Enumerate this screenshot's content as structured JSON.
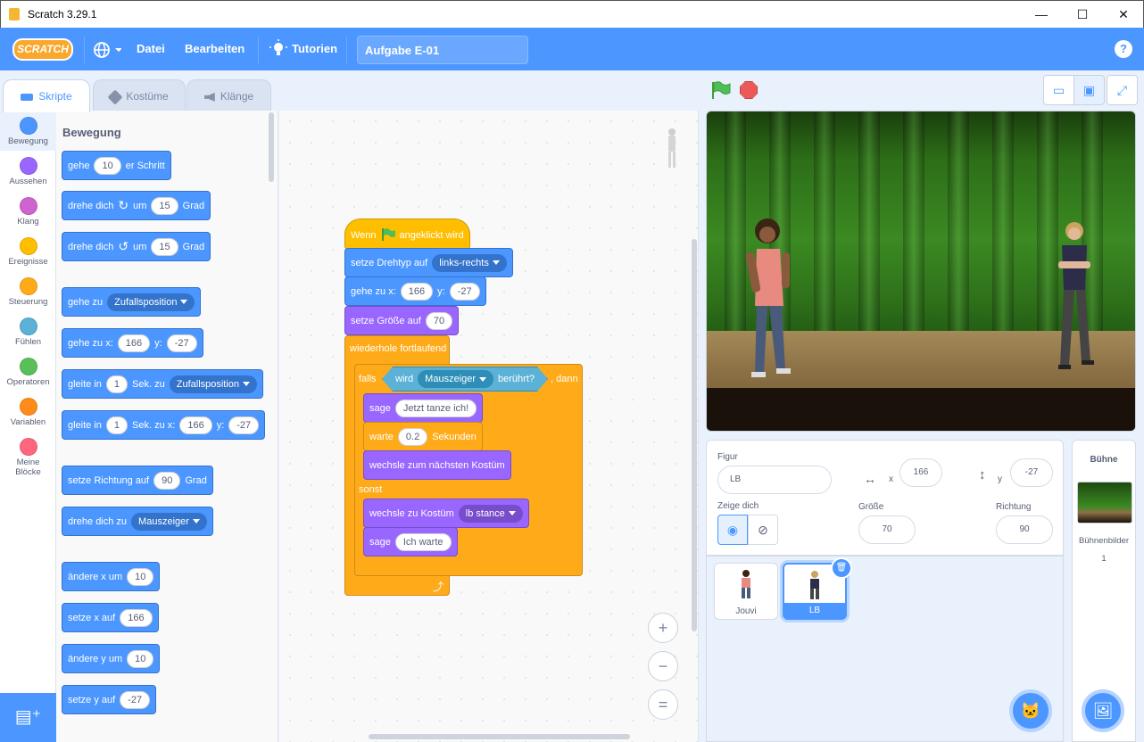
{
  "window": {
    "title": "Scratch 3.29.1",
    "minimize": "—",
    "maximize": "☐",
    "close": "✕"
  },
  "menu": {
    "logo": "SCRATCH",
    "language_icon": "globe-icon",
    "file": "Datei",
    "edit": "Bearbeiten",
    "tutorials": "Tutorien",
    "project_title": "Aufgabe E-01",
    "help": "?"
  },
  "tabs": [
    {
      "label": "Skripte"
    },
    {
      "label": "Kostüme"
    },
    {
      "label": "Klänge"
    }
  ],
  "categories": [
    {
      "label": "Bewegung",
      "color": "#4c97ff"
    },
    {
      "label": "Aussehen",
      "color": "#9966ff"
    },
    {
      "label": "Klang",
      "color": "#cf63cf"
    },
    {
      "label": "Ereignisse",
      "color": "#ffbf00"
    },
    {
      "label": "Steuerung",
      "color": "#ffab19"
    },
    {
      "label": "Fühlen",
      "color": "#5cb1d6"
    },
    {
      "label": "Operatoren",
      "color": "#59c059"
    },
    {
      "label": "Variablen",
      "color": "#ff8c1a"
    },
    {
      "label": "Meine Blöcke",
      "color": "#ff6680"
    }
  ],
  "palette": {
    "heading": "Bewegung",
    "b1": {
      "t1": "gehe",
      "v1": "10",
      "t2": "er Schritt"
    },
    "b2": {
      "t1": "drehe dich",
      "t2": "um",
      "v1": "15",
      "t3": "Grad"
    },
    "b3": {
      "t1": "drehe dich",
      "t2": "um",
      "v1": "15",
      "t3": "Grad"
    },
    "b4": {
      "t1": "gehe zu",
      "d1": "Zufallsposition"
    },
    "b5": {
      "t1": "gehe zu x:",
      "v1": "166",
      "t2": "y:",
      "v2": "-27"
    },
    "b6": {
      "t1": "gleite in",
      "v1": "1",
      "t2": "Sek. zu",
      "d1": "Zufallsposition"
    },
    "b7": {
      "t1": "gleite in",
      "v1": "1",
      "t2": "Sek. zu x:",
      "v2": "166",
      "t3": "y:",
      "v3": "-27"
    },
    "b8": {
      "t1": "setze Richtung auf",
      "v1": "90",
      "t2": "Grad"
    },
    "b9": {
      "t1": "drehe dich zu",
      "d1": "Mauszeiger"
    },
    "b10": {
      "t1": "ändere x um",
      "v1": "10"
    },
    "b11": {
      "t1": "setze x auf",
      "v1": "166"
    },
    "b12": {
      "t1": "ändere y um",
      "v1": "10"
    },
    "b13": {
      "t1": "setze y auf",
      "v1": "-27"
    }
  },
  "script": {
    "hat": {
      "t1": "Wenn",
      "t2": "angeklickt wird"
    },
    "s1": {
      "t1": "setze Drehtyp auf",
      "d1": "links-rechts"
    },
    "s2": {
      "t1": "gehe zu x:",
      "v1": "166",
      "t2": "y:",
      "v2": "-27"
    },
    "s3": {
      "t1": "setze Größe auf",
      "v1": "70"
    },
    "forever": "wiederhole fortlaufend",
    "if": {
      "t1": "falls",
      "t2": "wird",
      "d1": "Mauszeiger",
      "t3": "berührt?",
      "t4": ", dann"
    },
    "say1": {
      "t1": "sage",
      "v1": "Jetzt tanze ich!"
    },
    "wait": {
      "t1": "warte",
      "v1": "0.2",
      "t2": "Sekunden"
    },
    "next": "wechsle zum nächsten Kostüm",
    "else": "sonst",
    "costume": {
      "t1": "wechsle zu Kostüm",
      "d1": "lb stance"
    },
    "say2": {
      "t1": "sage",
      "v1": "Ich warte"
    }
  },
  "zoom": {
    "in": "+",
    "out": "−",
    "reset": "="
  },
  "sprite": {
    "label": "Figur",
    "name": "LB",
    "x_label": "x",
    "x": "166",
    "y_label": "y",
    "y": "-27",
    "show_label": "Zeige dich",
    "size_label": "Größe",
    "size": "70",
    "dir_label": "Richtung",
    "dir": "90"
  },
  "sprites": [
    {
      "name": "Jouvi"
    },
    {
      "name": "LB"
    }
  ],
  "stage_panel": {
    "title": "Bühne",
    "backdrops_label": "Bühnenbilder",
    "backdrops_count": "1"
  }
}
